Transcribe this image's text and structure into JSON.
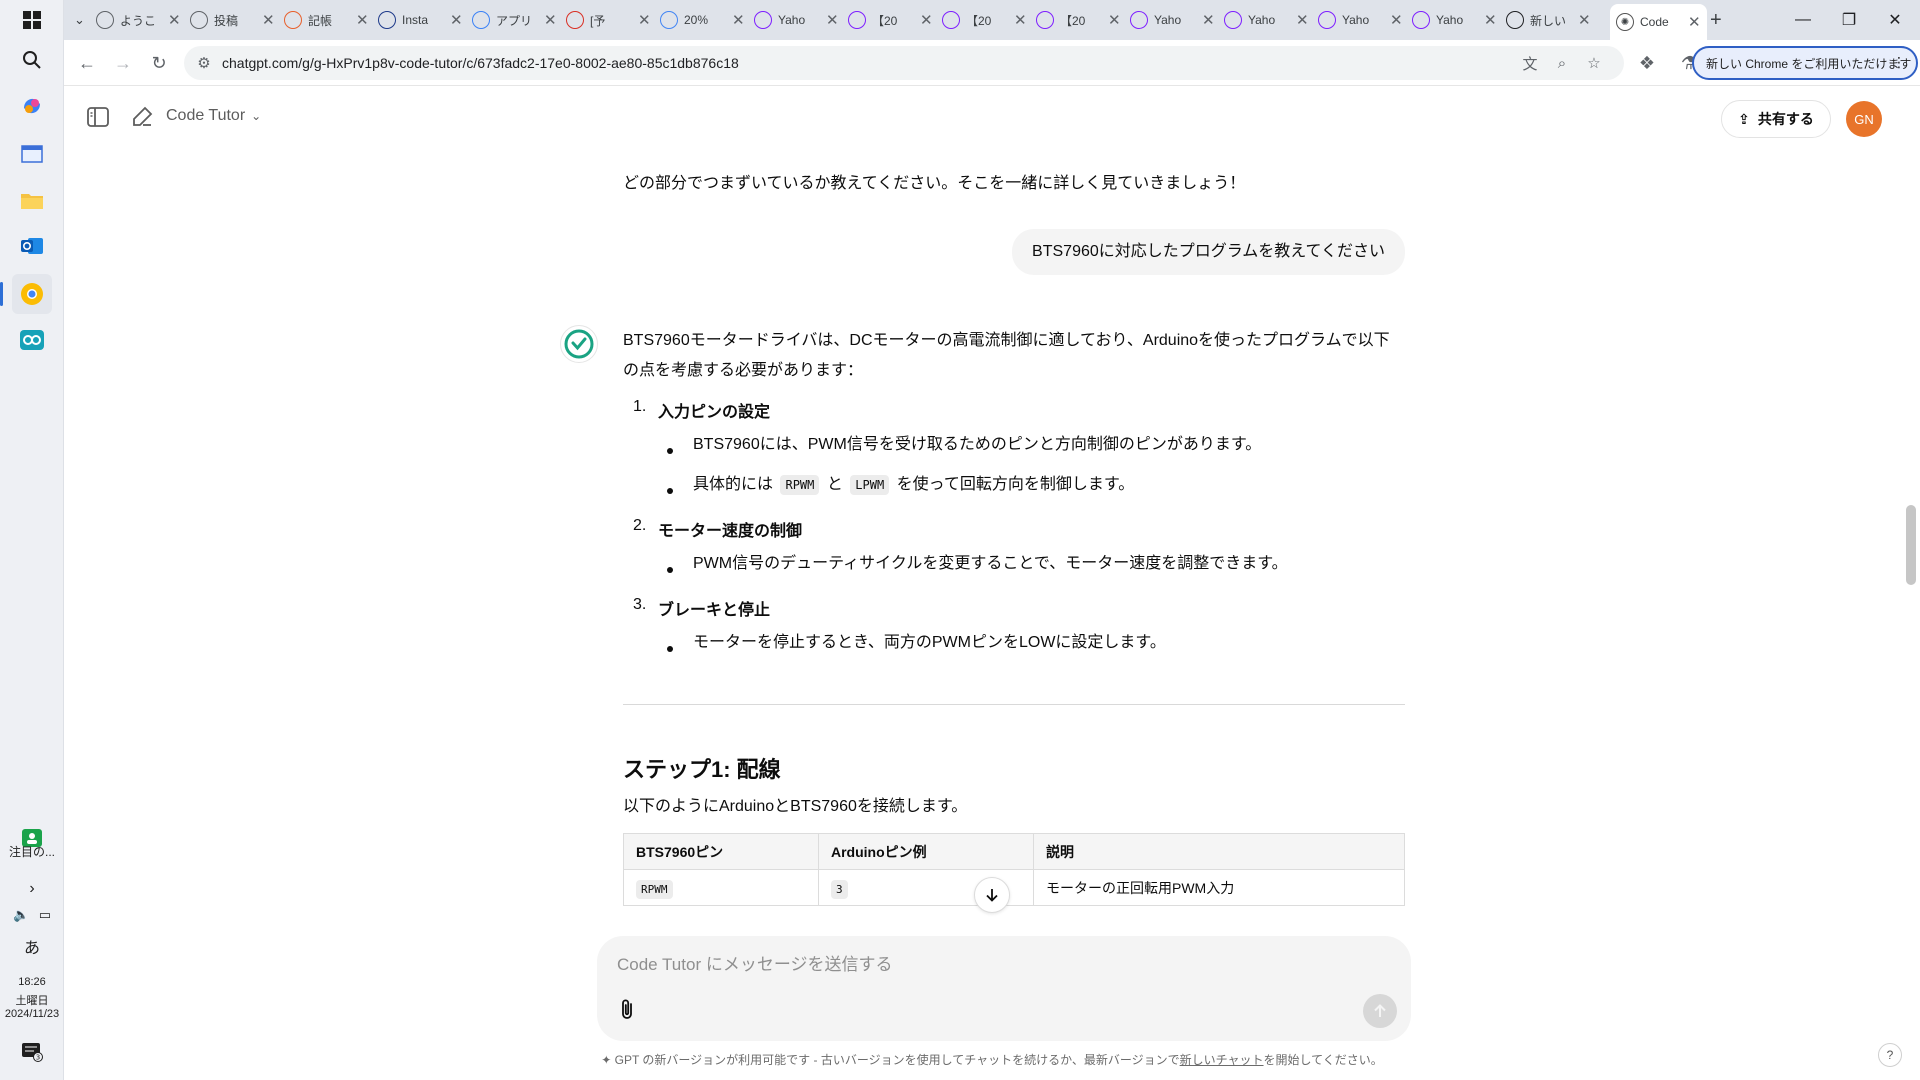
{
  "taskbar": {
    "widget_label": "注目の...",
    "ime": "あ",
    "time": "18:26",
    "weekday": "土曜日",
    "date": "2024/11/23",
    "notification_count": "3"
  },
  "tabs": [
    {
      "label": "ようこ",
      "color": "#5f6368"
    },
    {
      "label": "投稿",
      "color": "#5f6368"
    },
    {
      "label": "記帳",
      "color": "#e8602c"
    },
    {
      "label": "Insta",
      "color": "#1e3a8a"
    },
    {
      "label": "アプリ",
      "color": "#3b82f6"
    },
    {
      "label": "[予",
      "color": "#d93025"
    },
    {
      "label": "20%",
      "color": "#4285f4"
    },
    {
      "label": "Yaho",
      "color": "#7e1fff"
    },
    {
      "label": "【20",
      "color": "#7e1fff"
    },
    {
      "label": "【20",
      "color": "#7e1fff"
    },
    {
      "label": "【20",
      "color": "#7e1fff"
    },
    {
      "label": "Yaho",
      "color": "#7e1fff"
    },
    {
      "label": "Yaho",
      "color": "#7e1fff"
    },
    {
      "label": "Yaho",
      "color": "#7e1fff"
    },
    {
      "label": "Yaho",
      "color": "#7e1fff"
    },
    {
      "label": "新しい",
      "color": "#202124"
    }
  ],
  "active_tab": {
    "label": "Code"
  },
  "address_bar": {
    "url": "chatgpt.com/g/g-HxPrv1p8v-code-tutor/c/673fadc2-17e0-8002-ae80-85c1db876c18",
    "chrome_promo": "新しい Chrome をご利用いただけます"
  },
  "header": {
    "gpt_name": "Code Tutor",
    "share_label": "共有する",
    "avatar_initials": "GN"
  },
  "messages": {
    "prev_assistant_tail": "どの部分でつまずいているか教えてください。そこを一緒に詳しく見ていきましょう！",
    "user": "BTS7960に対応したプログラムを教えてください",
    "intro": "BTS7960モータードライバは、DCモーターの高電流制御に適しており、Arduinoを使ったプログラムで以下の点を考慮する必要があります：",
    "items": [
      {
        "num": "1.",
        "title": "入力ピンの設定",
        "bullets": [
          "BTS7960には、PWM信号を受け取るためのピンと方向制御のピンがあります。"
        ],
        "bullet2_prefix": "具体的には",
        "bullet2_code1": "RPWM",
        "bullet2_mid": "と",
        "bullet2_code2": "LPWM",
        "bullet2_suffix": "を使って回転方向を制御します。"
      },
      {
        "num": "2.",
        "title": "モーター速度の制御",
        "bullets": [
          "PWM信号のデューティサイクルを変更することで、モーター速度を調整できます。"
        ]
      },
      {
        "num": "3.",
        "title": "ブレーキと停止",
        "bullets": [
          "モーターを停止するとき、両方のPWMピンをLOWに設定します。"
        ]
      }
    ],
    "step1_heading": "ステップ1: 配線",
    "step1_text": "以下のようにArduinoとBTS7960を接続します。",
    "table": {
      "headers": [
        "BTS7960ピン",
        "Arduinoピン例",
        "説明"
      ],
      "rows": [
        [
          "RPWM",
          "3",
          "モーターの正回転用PWM入力"
        ]
      ]
    }
  },
  "composer": {
    "placeholder": "Code Tutor にメッセージを送信する"
  },
  "footer": {
    "text_before": "GPT の新バージョンが利用可能です - 古いバージョンを使用してチャットを続けるか、最新バージョンで",
    "link": "新しいチャット",
    "text_after": "を開始してください。",
    "help": "?"
  },
  "colors": {
    "accent_taskbar": "#2d6fd6",
    "avatar_bg": "#e8742a",
    "codetutor_icon": "#1aa383"
  }
}
